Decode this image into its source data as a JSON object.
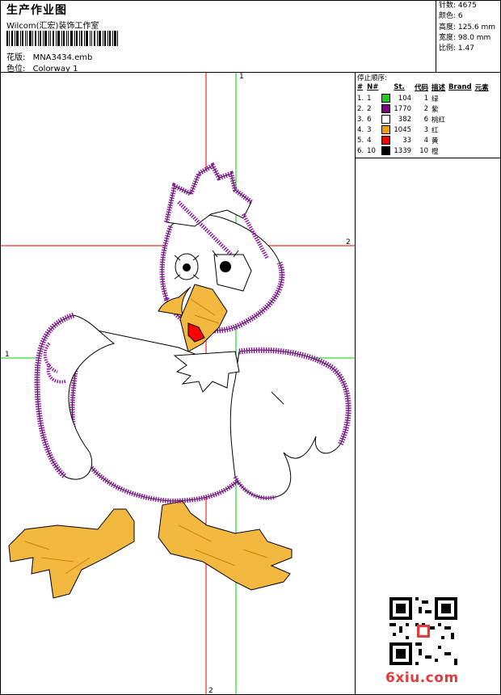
{
  "header": {
    "title": "生产作业图",
    "company": "Wilcom(汇宏)装饰工作室",
    "design_file_label": "花版:",
    "design_file": "MNA3434.emb",
    "colorway_label": "色位:",
    "colorway": "Colorway 1"
  },
  "stats": {
    "stitches": "针数: 4675",
    "colors": "颜色: 6",
    "height": "高度: 125.6 mm",
    "width": "宽度: 98.0 mm",
    "ratio": "比例: 1.47"
  },
  "color_stops": {
    "title": "停止顺序:",
    "headers": [
      "#",
      "N#",
      "St.",
      "代码",
      "描述",
      "Brand",
      "元素"
    ],
    "rows": [
      {
        "idx": "1.",
        "n": "1",
        "color": "#22cc22",
        "st": "104",
        "code": "1",
        "desc": "绿"
      },
      {
        "idx": "2.",
        "n": "2",
        "color": "#800080",
        "st": "1770",
        "code": "2",
        "desc": "紫"
      },
      {
        "idx": "3.",
        "n": "6",
        "color": "#ffffff",
        "st": "382",
        "code": "6",
        "desc": "桃红"
      },
      {
        "idx": "4.",
        "n": "3",
        "color": "#f0a000",
        "st": "1045",
        "code": "3",
        "desc": "红"
      },
      {
        "idx": "5.",
        "n": "4",
        "color": "#ff0000",
        "st": "33",
        "code": "4",
        "desc": "黄"
      },
      {
        "idx": "6.",
        "n": "10",
        "color": "#000000",
        "st": "1339",
        "code": "10",
        "desc": "橙"
      }
    ]
  },
  "guides": {
    "top_label": "1",
    "right_label": "2",
    "left_label": "1",
    "bottom_label": "2"
  },
  "watermark": "6xiu.com",
  "colors": {
    "guide_red": "#e00000",
    "guide_green": "#00cc00",
    "outline_purple": "#8a1a9a",
    "fill_orange": "#f0a000",
    "beak_red": "#ff0000"
  }
}
